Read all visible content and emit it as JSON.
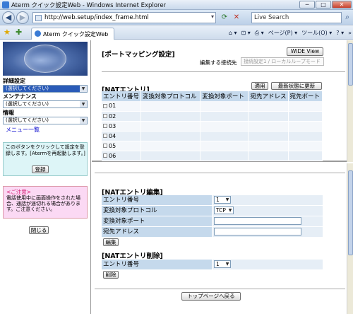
{
  "window": {
    "title": "Aterm クイック設定Web - Windows Internet Explorer",
    "minimize_glyph": "─",
    "maximize_glyph": "□",
    "close_glyph": "✕"
  },
  "toolbar": {
    "back_glyph": "◀",
    "forward_glyph": "▶",
    "url": "http://web.setup/index_frame.html",
    "url_drop_glyph": "▾",
    "refresh_glyph": "⟳",
    "stop_glyph": "✕",
    "search_placeholder": "Live Search",
    "search_glyph": "⌕"
  },
  "tabs": {
    "fav_glyph": "★",
    "add_fav_glyph": "✚",
    "active_tab_label": "Aterm クイック設定Web",
    "commands": [
      "⌂ ▾",
      "⊡ ▾",
      "⎙ ▾",
      "ページ(P) ▾",
      "ツール(O) ▾",
      "? ▾",
      "»"
    ]
  },
  "sidebar": {
    "groups": [
      {
        "label": "詳細設定",
        "select_value": "(選択してください)",
        "selected": true
      },
      {
        "label": "メンテナンス",
        "select_value": "(選択してください)",
        "selected": false
      },
      {
        "label": "情報",
        "select_value": "(選択してください)",
        "selected": false
      }
    ],
    "menu_link": "メニュー一覧",
    "register_info": "このボタンをクリックして設定を登録します。[Atermを再起動します。]",
    "register_button": "登録",
    "caution_head": "<ご注意>",
    "caution_text": "電話使用中に画面操作をされた場合、通話が途切れる場合があります。ご注意ください。",
    "close_button": "閉じる"
  },
  "upper": {
    "title": "[ポートマッピング設定]",
    "wide_view_button": "WIDE View",
    "connection_label": "編集する接続先",
    "connection_value": "接続設定1 / ローカルループモード",
    "nat_title": "[NATエントリ]",
    "apply_button": "適用",
    "refresh_button": "最新状態に更新",
    "columns": [
      "エントリ番号",
      "変換対象プロトコル",
      "変換対象ポート",
      "宛先アドレス",
      "宛先ポート"
    ],
    "rows": [
      "01",
      "02",
      "03",
      "04",
      "05",
      "06"
    ]
  },
  "lower": {
    "edit_title": "[NATエントリ編集]",
    "entry_label": "エントリ番号",
    "entry_value": "1",
    "protocol_label": "変換対象プロトコル",
    "protocol_value": "TCP",
    "port_label": "変換対象ポート",
    "port_value": "",
    "addr_label": "宛先アドレス",
    "addr_value": "",
    "edit_button": "編集",
    "delete_title": "[NATエントリ削除]",
    "delete_entry_label": "エントリ番号",
    "delete_entry_value": "1",
    "delete_button": "削除",
    "top_button": "トップページへ戻る"
  }
}
